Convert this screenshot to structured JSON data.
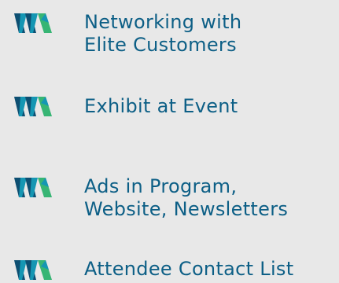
{
  "colors": {
    "background": "#e8e8e8",
    "text": "#0d5f86",
    "logo_dark": "#0d4f72",
    "logo_mid": "#1596b3",
    "logo_green": "#37b574"
  },
  "items": [
    {
      "icon": "wa-logo-icon",
      "lines": [
        "Networking with",
        "Elite Customers"
      ]
    },
    {
      "icon": "wa-logo-icon",
      "lines": [
        "Exhibit at Event"
      ]
    },
    {
      "icon": "wa-logo-icon",
      "lines": [
        "Ads in Program,",
        "Website, Newsletters"
      ]
    },
    {
      "icon": "wa-logo-icon",
      "lines": [
        "Attendee Contact List"
      ]
    }
  ]
}
